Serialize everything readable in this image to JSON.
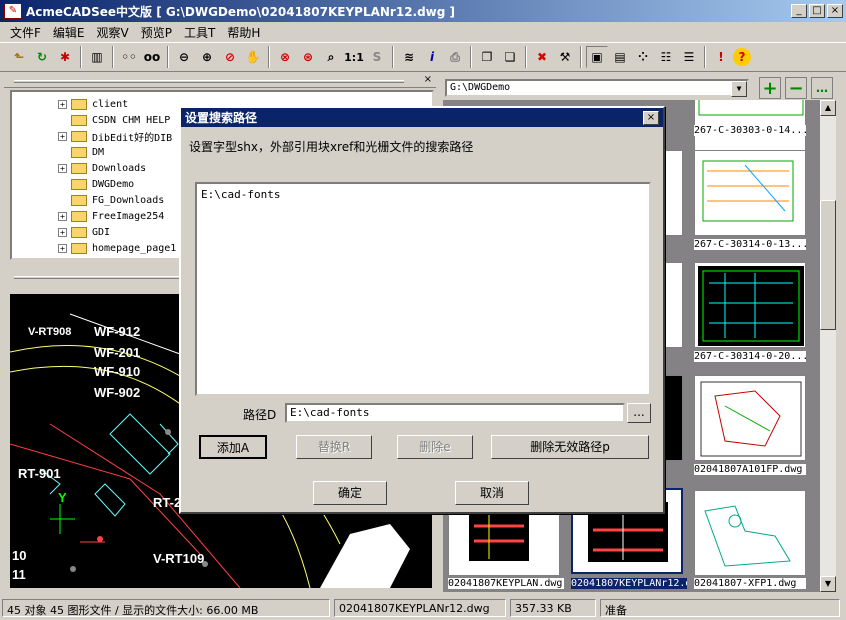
{
  "window": {
    "title": "AcmeCADSee中文版 [ G:\\DWGDemo\\02041807KEYPLANr12.dwg ]",
    "min": "_",
    "max": "□",
    "close": "×"
  },
  "menu": [
    "文件F",
    "编辑E",
    "观察V",
    "预览P",
    "工具T",
    "帮助H"
  ],
  "path_combo": {
    "value": "G:\\DWGDemo"
  },
  "tree": [
    {
      "name": "client",
      "expand": true
    },
    {
      "name": "CSDN CHM HELP",
      "expand": false
    },
    {
      "name": "DibEdit好的DIB",
      "expand": true
    },
    {
      "name": "DM",
      "expand": false
    },
    {
      "name": "Downloads",
      "expand": true
    },
    {
      "name": "DWGDemo",
      "expand": false
    },
    {
      "name": "FG_Downloads",
      "expand": false
    },
    {
      "name": "FreeImage254",
      "expand": true
    },
    {
      "name": "GDI",
      "expand": true
    },
    {
      "name": "homepage_page1",
      "expand": true
    }
  ],
  "cad_labels": [
    "V-RT908",
    "WF-912",
    "WF-201",
    "WF-910",
    "WF-902",
    "RT-901",
    "RT-2",
    "V-RT109",
    "10",
    "11",
    "Y"
  ],
  "thumbnails": [
    {
      "name": "267-C-30303-0-14..."
    },
    {
      "name": "267-C-30314-0-13..."
    },
    {
      "name": "267-C-30314-0-20..."
    },
    {
      "name": "02041807A101FP.dwg"
    },
    {
      "name": "02041807KEYPLAN.dwg"
    },
    {
      "name": "02041807KEYPLANr12.dwg"
    },
    {
      "name": "02041807-XFP1.dwg"
    }
  ],
  "dialog": {
    "title": "设置搜索路径",
    "description": "设置字型shx，外部引用块xref和光栅文件的搜索路径",
    "list_items": [
      "E:\\cad-fonts"
    ],
    "path_label": "路径D",
    "path_value": "E:\\cad-fonts",
    "browse": "...",
    "add": "添加A",
    "replace": "替换R",
    "delete": "删除e",
    "delete_invalid": "删除无效路径p",
    "ok": "确定",
    "cancel": "取消"
  },
  "status": {
    "count": "45 对象 45 图形文件 / 显示的文件大小: 66.00 MB",
    "file": "02041807KEYPLANr12.dwg",
    "size": "357.33 KB",
    "state": "准备"
  }
}
